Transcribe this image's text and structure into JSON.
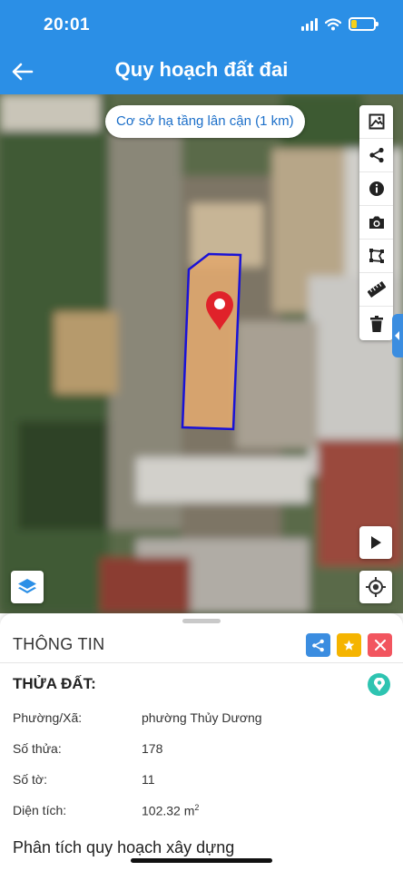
{
  "status": {
    "time": "20:01",
    "battery_percent": 25
  },
  "header": {
    "title": "Quy hoạch đất đai",
    "back_icon": "arrow-left-icon"
  },
  "map": {
    "chip_label": "Cơ sở hạ tầng lân cận (1 km)",
    "tools": [
      "image-icon",
      "share-icon",
      "info-icon",
      "camera-icon",
      "polygon-icon",
      "ruler-icon",
      "trash-icon"
    ],
    "parcel_fill": "#e0a86f",
    "parcel_stroke": "#1a12d6",
    "pin_color": "#e0222a"
  },
  "sheet": {
    "title": "THÔNG TIN",
    "actions": [
      {
        "name": "share",
        "color": "#3b8de0"
      },
      {
        "name": "favorite",
        "color": "#f5b400"
      },
      {
        "name": "close",
        "color": "#f2555f"
      }
    ],
    "section_title": "THỬA ĐẤT:",
    "fields": [
      {
        "label": "Phường/Xã:",
        "value": "phường Thủy Dương"
      },
      {
        "label": "Số thửa:",
        "value": "178"
      },
      {
        "label": "Số tờ:",
        "value": "11"
      },
      {
        "label": "Diện tích:",
        "value": "102.32 m",
        "unit_sup": "2"
      }
    ],
    "analysis_title": "Phân tích quy hoạch xây dựng"
  }
}
